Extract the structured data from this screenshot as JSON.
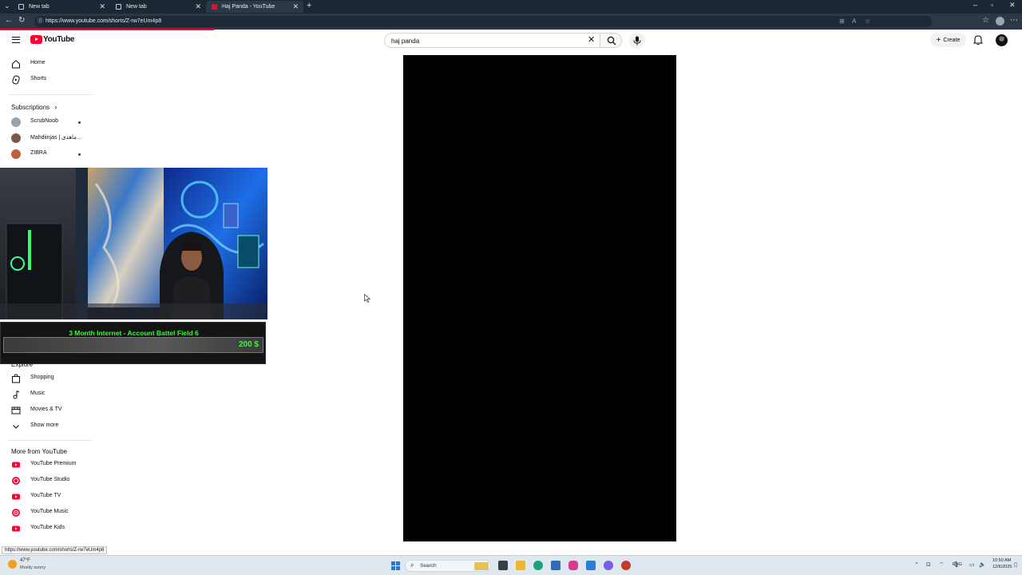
{
  "browser": {
    "tabs": [
      {
        "title": "New tab",
        "active": false
      },
      {
        "title": "New tab",
        "active": false
      },
      {
        "title": "Haj Panda - YouTube",
        "active": true
      }
    ],
    "url": "https://www.youtube.com/shorts/Z-rw7eUm4p8",
    "status_url": "https://www.youtube.com/shorts/Z-rw7eUm4p8"
  },
  "header": {
    "logo_text": "YouTube",
    "search_value": "haj panda",
    "create_label": "Create"
  },
  "sidebar": {
    "primary": [
      {
        "label": "Home",
        "icon": "home-icon"
      },
      {
        "label": "Shorts",
        "icon": "shorts-icon"
      }
    ],
    "subscriptions_heading": "Subscriptions",
    "subscriptions": [
      {
        "label": "ScrubNoob",
        "color": "#9aa3ad"
      },
      {
        "label": "Mahdiinjas | ماهدی...",
        "color": "#7b5a4a"
      },
      {
        "label": "ZIBRA",
        "color": "#c0613a"
      }
    ],
    "explore_heading": "Explore",
    "explore": [
      {
        "label": "Shopping",
        "icon": "shopping-bag-icon"
      },
      {
        "label": "Music",
        "icon": "music-note-icon"
      },
      {
        "label": "Movies & TV",
        "icon": "film-icon"
      },
      {
        "label": "Show more",
        "icon": "chevron-down-icon"
      }
    ],
    "more_heading": "More from YouTube",
    "more": [
      {
        "label": "YouTube Premium",
        "icon": "youtube-premium-icon"
      },
      {
        "label": "YouTube Studio",
        "icon": "youtube-studio-icon"
      },
      {
        "label": "YouTube TV",
        "icon": "youtube-tv-icon"
      },
      {
        "label": "YouTube Music",
        "icon": "youtube-music-icon"
      },
      {
        "label": "YouTube Kids",
        "icon": "youtube-kids-icon"
      }
    ]
  },
  "overlay": {
    "donation_title": "3 Month Internet - Account Battel Field 6",
    "donation_amount": "200 $"
  },
  "taskbar": {
    "weather_temp": "47°F",
    "weather_desc": "Mostly sunny",
    "search_label": "Search",
    "language": "ENG",
    "time": "10:50 AM",
    "date": "12/6/2025"
  }
}
